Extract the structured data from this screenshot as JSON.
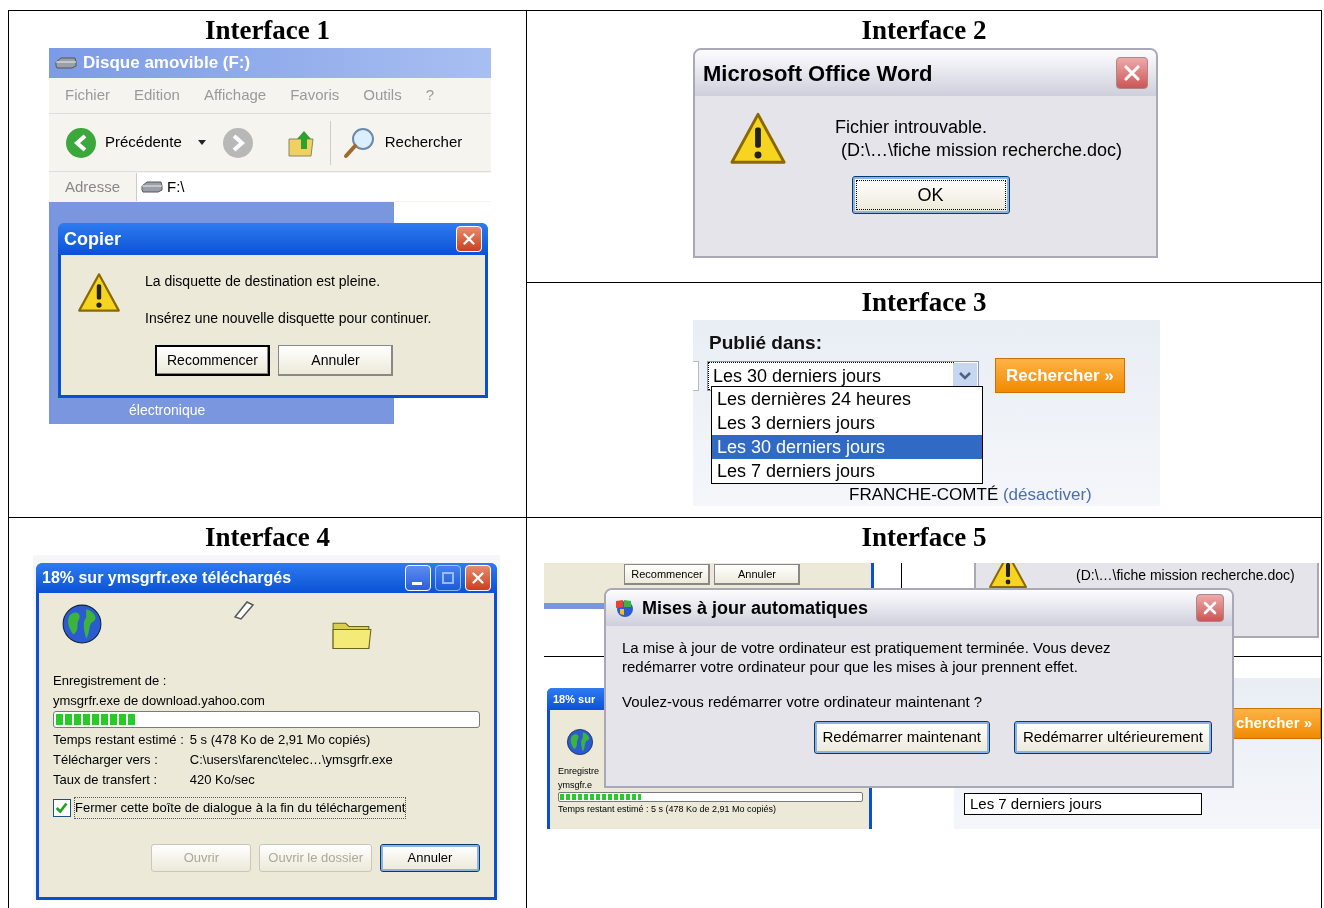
{
  "interface_1": {
    "heading": "Interface 1",
    "explorer": {
      "title": "Disque amovible (F:)",
      "menu": [
        "Fichier",
        "Edition",
        "Affichage",
        "Favoris",
        "Outils",
        "?"
      ],
      "back_label": "Précédente",
      "search_label": "Rechercher",
      "address_label": "Adresse",
      "address": "F:\\",
      "folder_label": "électronique"
    },
    "dialog": {
      "title": "Copier",
      "lines": [
        "La disquette de destination est pleine.",
        "Insérez une nouvelle disquette pour continuer."
      ],
      "buttons": [
        {
          "label": "Recommencer",
          "focused": true
        },
        {
          "label": "Annuler",
          "focused": false
        }
      ]
    }
  },
  "interface_2": {
    "heading": "Interface 2",
    "dialog": {
      "title": "Microsoft Office Word",
      "lines": [
        "Fichier introuvable.",
        "(D:\\…\\fiche mission recherche.doc)"
      ],
      "buttons": [
        {
          "label": "OK",
          "focused": true
        }
      ]
    }
  },
  "interface_3": {
    "heading": "Interface 3",
    "label": "Publié dans:",
    "select_value": "Les 30 derniers jours",
    "options": [
      {
        "label": "Les dernières 24 heures",
        "selected": false
      },
      {
        "label": "Les 3 derniers jours",
        "selected": false
      },
      {
        "label": "Les 30 derniers jours",
        "selected": true
      },
      {
        "label": "Les 7 derniers jours",
        "selected": false
      }
    ],
    "search_button": "Rechercher »",
    "region": "FRANCHE-COMTÉ",
    "region_link": "(désactiver)"
  },
  "interface_4": {
    "heading": "Interface 4",
    "title": "18% sur ymsgrfr.exe téléchargés",
    "saving_label": "Enregistrement de :",
    "source": "ymsgrfr.exe de download.yahoo.com",
    "progress": {
      "level": 0.19
    },
    "details": [
      {
        "label": "Temps restant estimé :",
        "value": "5 s (478 Ko de 2,91 Mo copiés)"
      },
      {
        "label": "Télécharger vers :",
        "value": "C:\\users\\farenc\\telec…\\ymsgrfr.exe"
      },
      {
        "label": "Taux de transfert :",
        "value": "420 Ko/sec"
      }
    ],
    "close_when_done": {
      "label": "Fermer cette boîte de dialogue à la fin du téléchargement",
      "checked": true
    },
    "buttons": [
      {
        "label": "Ouvrir",
        "disabled": true
      },
      {
        "label": "Ouvrir le dossier",
        "disabled": true
      },
      {
        "label": "Annuler",
        "disabled": false
      }
    ]
  },
  "interface_5": {
    "heading": "Interface 5",
    "background": {
      "buttons": [
        "Recommencer",
        "Annuler"
      ],
      "path_text": "(D:\\…\\fiche mission recherche.doc)",
      "download_title": "18% sur",
      "download_lines": [
        "Enregistre",
        "ymsgfr.e"
      ],
      "download_status": "Temps restant estimé : 5 s (478 Ko de 2,91 Mo copiés)",
      "download_progress": {
        "level": 0.27
      },
      "search_button": "chercher »",
      "option": "Les 7 derniers jours"
    },
    "dialog": {
      "title": "Mises à jour automatiques",
      "paragraphs": [
        "La mise à jour de votre ordinateur est pratiquement terminée. Vous devez redémarrer votre ordinateur pour que les mises à jour prennent effet.",
        "Voulez-vous redémarrer votre ordinateur maintenant ?"
      ],
      "buttons": [
        "Redémarrer maintenant",
        "Redémarrer ultérieurement"
      ]
    }
  }
}
